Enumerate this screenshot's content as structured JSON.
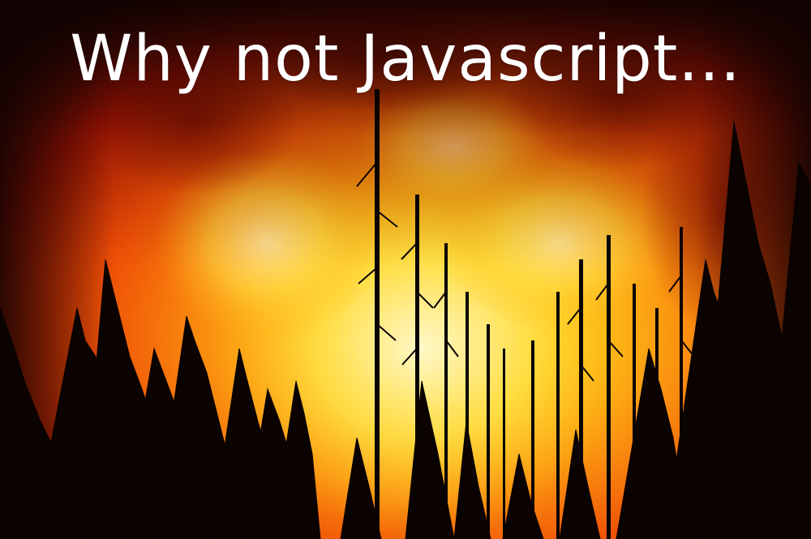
{
  "slide": {
    "caption": "Why not Javascript..."
  },
  "photo": {
    "subject": "forest-fire",
    "colors": {
      "sky_dark": "#1a0402",
      "flame_red": "#d81e04",
      "flame_orange": "#f76a0a",
      "flame_yellow": "#ffd21a",
      "flame_core": "#fff2a0",
      "tree_silhouette": "#0b0302",
      "caption_text": "#ffffff"
    }
  }
}
